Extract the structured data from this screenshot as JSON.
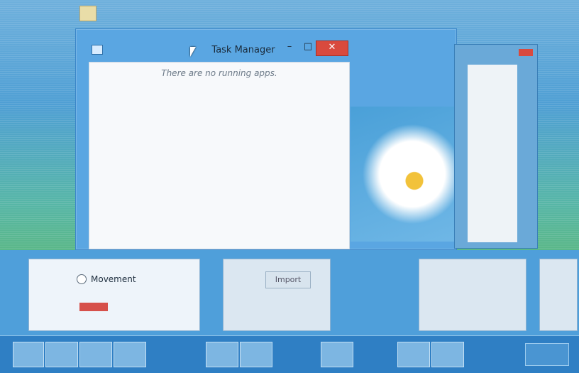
{
  "window": {
    "title": "Task Manager",
    "empty_message": "There are no running apps.",
    "buttons": {
      "minimize": "–",
      "maximize": "□",
      "close": "✕"
    },
    "icons": {
      "app": "task-manager-icon"
    }
  },
  "switcher": {
    "option_label": "Movement",
    "import_label": "Import"
  },
  "colors": {
    "desktop": "#4f9fd4",
    "title_bar": "#5aa6e2",
    "close_button": "#d94a3e",
    "body": "#f7f9fb",
    "taskbar": "#2f7fc4"
  }
}
